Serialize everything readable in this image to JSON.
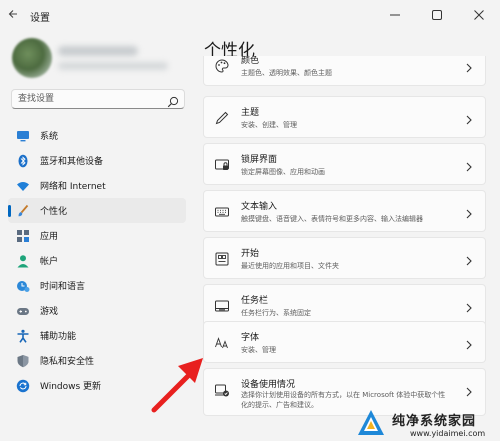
{
  "window": {
    "title": "设置"
  },
  "search": {
    "placeholder": "查找设置"
  },
  "sidebar": {
    "items": [
      {
        "label": "系统",
        "icon": "monitor-icon"
      },
      {
        "label": "蓝牙和其他设备",
        "icon": "bluetooth-icon"
      },
      {
        "label": "网络和 Internet",
        "icon": "wifi-icon"
      },
      {
        "label": "个性化",
        "icon": "brush-icon",
        "active": true
      },
      {
        "label": "应用",
        "icon": "apps-icon"
      },
      {
        "label": "帐户",
        "icon": "person-icon"
      },
      {
        "label": "时间和语言",
        "icon": "clock-globe-icon"
      },
      {
        "label": "游戏",
        "icon": "gamepad-icon"
      },
      {
        "label": "辅助功能",
        "icon": "accessibility-icon"
      },
      {
        "label": "隐私和安全性",
        "icon": "shield-icon"
      },
      {
        "label": "Windows 更新",
        "icon": "windows-update-icon"
      }
    ]
  },
  "main": {
    "title": "个性化",
    "cards": [
      {
        "title": "颜色",
        "desc": "主题色、透明效果、颜色主题",
        "icon": "palette-icon"
      },
      {
        "title": "主题",
        "desc": "安装、创建、管理",
        "icon": "pen-icon"
      },
      {
        "title": "锁屏界面",
        "desc": "锁定屏幕图像、应用和动画",
        "icon": "lock-screen-icon"
      },
      {
        "title": "文本输入",
        "desc": "触摸键盘、语音键入、表情符号和更多内容、输入法编辑器",
        "icon": "keyboard-icon"
      },
      {
        "title": "开始",
        "desc": "最近使用的应用和项目、文件夹",
        "icon": "start-icon"
      },
      {
        "title": "任务栏",
        "desc": "任务栏行为、系统固定",
        "icon": "taskbar-icon"
      },
      {
        "title": "字体",
        "desc": "安装、管理",
        "icon": "font-icon"
      },
      {
        "title": "设备使用情况",
        "desc": "选择你计划使用设备的所有方式，以在 Microsoft 体验中获取个性化的提示、广告和建议。",
        "icon": "device-usage-icon"
      }
    ]
  },
  "watermark": {
    "title": "纯净系统家园",
    "url": "www.yidaimei.com"
  },
  "colors": {
    "accent": "#0067c0",
    "arrow": "#e8201f"
  }
}
